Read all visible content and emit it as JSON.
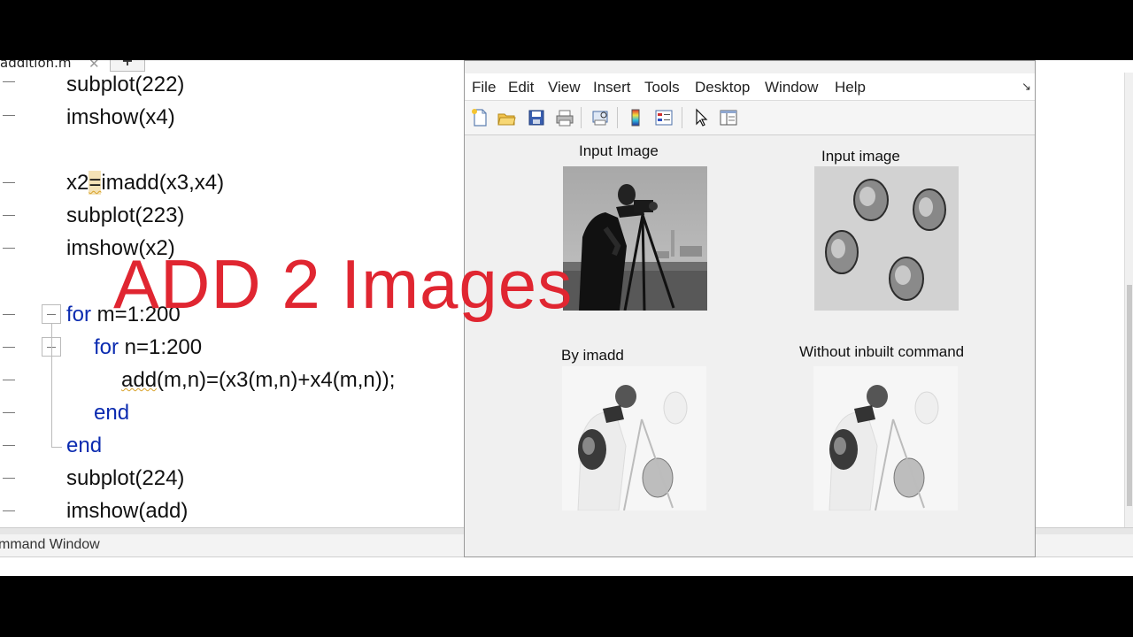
{
  "editor": {
    "tab_name": "addition.m",
    "tab_close": "✕",
    "tab_add": "+",
    "lines": [
      {
        "text": "subplot(222)"
      },
      {
        "text": "imshow(x4)"
      },
      {
        "text": ""
      },
      {
        "pre": "x2",
        "hl": "=",
        "post": "imadd(x3,x4)"
      },
      {
        "text": "subplot(223)"
      },
      {
        "text": "imshow(x2)"
      },
      {
        "text": ""
      },
      {
        "kw": "for",
        "text": " m=1:200"
      },
      {
        "kw": "for",
        "text": " n=1:200"
      },
      {
        "squig": "add",
        "text": "(m,n)=(x3(m,n)+x4(m,n));"
      },
      {
        "kw": "end",
        "text": ""
      },
      {
        "kw": "end",
        "text": ""
      },
      {
        "text": "subplot(224)"
      },
      {
        "text": "imshow(add)"
      }
    ]
  },
  "command_window": {
    "title": "mmand Window"
  },
  "figure": {
    "menu": [
      "File",
      "Edit",
      "View",
      "Insert",
      "Tools",
      "Desktop",
      "Window",
      "Help"
    ],
    "corner_glyph": "↘",
    "toolbar_icons": [
      "new-figure-icon",
      "open-folder-icon",
      "save-icon",
      "print-icon",
      "print-preview-icon",
      "colorbar-icon",
      "legend-icon",
      "pointer-arrow-icon",
      "property-editor-icon"
    ],
    "axes": [
      {
        "title": "Input Image",
        "image": "cameraman-photo"
      },
      {
        "title": "Input image",
        "image": "coins-photo"
      },
      {
        "title": "By imadd",
        "image": "added-result-photo"
      },
      {
        "title": "Without inbuilt command",
        "image": "manual-added-result-photo"
      }
    ]
  },
  "overlay": {
    "title": "ADD 2 Images",
    "color": "#e02631"
  }
}
